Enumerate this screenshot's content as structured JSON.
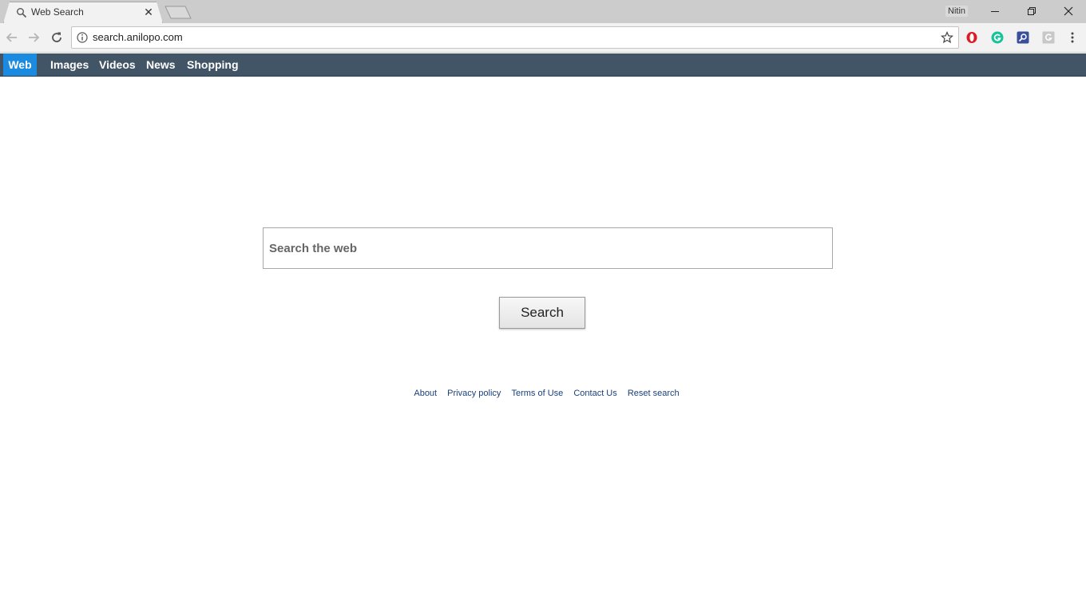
{
  "browser": {
    "tab_title": "Web Search",
    "profile_name": "Nitin",
    "url": "search.anilopo.com"
  },
  "nav": {
    "items": [
      {
        "label": "Web",
        "active": true
      },
      {
        "label": "Images",
        "active": false
      },
      {
        "label": "Videos",
        "active": false
      },
      {
        "label": "News",
        "active": false
      },
      {
        "label": "Shopping",
        "active": false
      }
    ]
  },
  "search": {
    "placeholder": "Search the web",
    "value": "",
    "button_label": "Search"
  },
  "footer": {
    "links": [
      "About",
      "Privacy policy",
      "Terms of Use",
      "Contact Us",
      "Reset search"
    ]
  },
  "colors": {
    "nav_bg": "#425566",
    "nav_active": "#1a8be0",
    "footer_link": "#1a3f7a"
  },
  "extensions": [
    "opera-icon",
    "grammarly-icon",
    "search-extension-icon",
    "google-extension-icon"
  ]
}
